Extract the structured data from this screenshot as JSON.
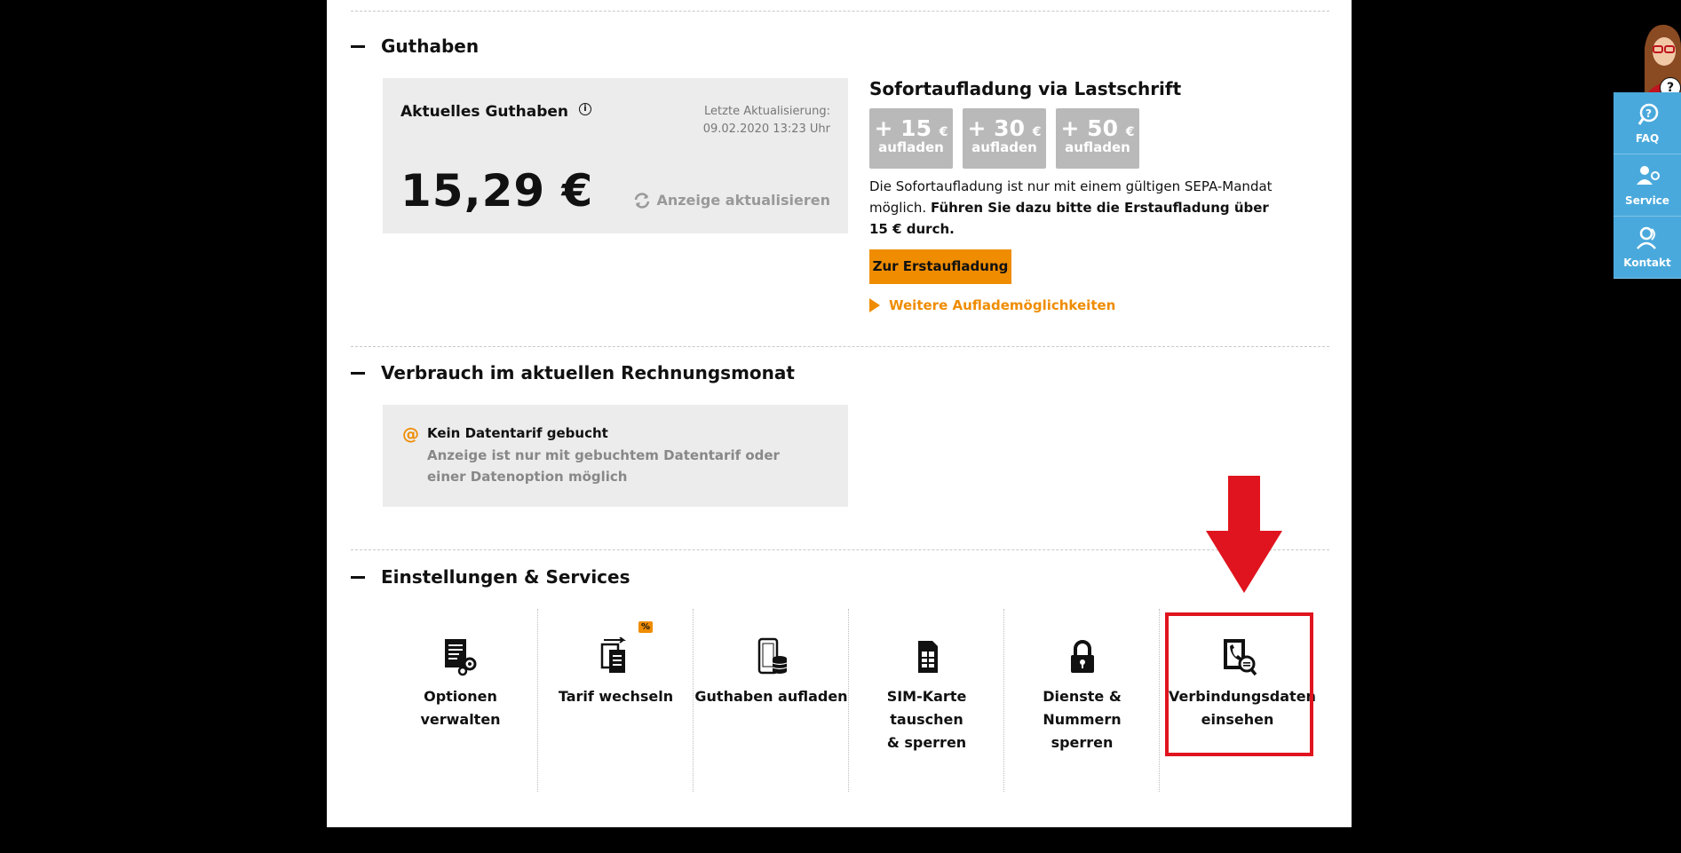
{
  "guthaben": {
    "section_title": "Guthaben",
    "current_label": "Aktuelles Guthaben",
    "last_update_label": "Letzte Aktualisierung:",
    "last_update_value": "09.02.2020 13:23 Uhr",
    "amount": "15,29 €",
    "refresh_label": "Anzeige aktualisieren"
  },
  "sofort": {
    "title": "Sofortaufladung via Lastschrift",
    "buttons": [
      {
        "amount": "+ 15",
        "currency": "€",
        "action": "aufladen"
      },
      {
        "amount": "+ 30",
        "currency": "€",
        "action": "aufladen"
      },
      {
        "amount": "+ 50",
        "currency": "€",
        "action": "aufladen"
      }
    ],
    "info_text": "Die Sofortaufladung ist nur mit einem gültigen SEPA-Mandat möglich.",
    "info_bold": "Führen Sie dazu bitte die Erstaufladung über 15 € durch.",
    "cta_label": "Zur Erstaufladung",
    "more_link": "Weitere Auflademöglichkeiten"
  },
  "verbrauch": {
    "section_title": "Verbrauch im aktuellen Rechnungsmonat",
    "no_tarif_title": "Kein Datentarif gebucht",
    "no_tarif_text": "Anzeige ist nur mit gebuchtem Datentarif oder einer Datenoption möglich"
  },
  "einstellungen": {
    "section_title": "Einstellungen & Services",
    "badge": "%",
    "tiles": [
      {
        "label": "Optionen verwalten",
        "icon": "document-gear-icon"
      },
      {
        "label": "Tarif wechseln",
        "icon": "tariff-switch-icon"
      },
      {
        "label": "Guthaben aufladen",
        "icon": "phone-coins-icon"
      },
      {
        "label": "SIM-Karte tauschen & sperren",
        "icon": "sim-card-icon"
      },
      {
        "label": "Dienste & Nummern sperren",
        "icon": "padlock-icon"
      },
      {
        "label": "Verbindungsdaten einsehen",
        "icon": "call-data-search-icon"
      }
    ]
  },
  "sidebar": {
    "help_badge": "?",
    "items": [
      {
        "label": "FAQ",
        "icon": "faq-icon"
      },
      {
        "label": "Service",
        "icon": "service-icon"
      },
      {
        "label": "Kontakt",
        "icon": "contact-icon"
      }
    ]
  },
  "colors": {
    "accent_orange": "#ef8c00",
    "highlight_red": "#e0141e",
    "sidebar_blue": "#4aa9dc",
    "button_gray": "#b9b9b9"
  }
}
